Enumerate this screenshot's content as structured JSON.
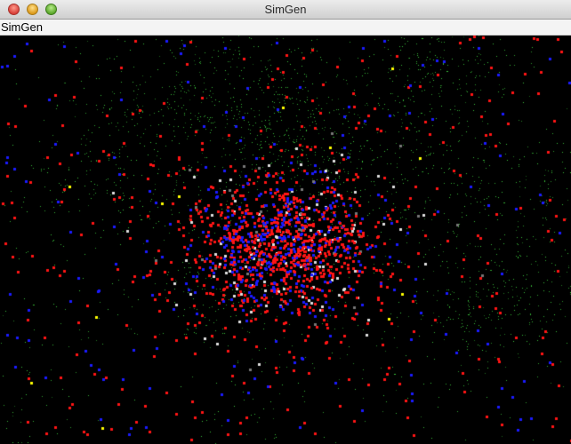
{
  "window": {
    "title": "SimGen"
  },
  "menubar": {
    "items": [
      {
        "label": "SimGen"
      }
    ]
  },
  "simulation": {
    "background": "#000000",
    "particle_colors": {
      "dust": "#39c43a",
      "red": "#ff1414",
      "blue": "#1a1aff",
      "white": "#dddddd",
      "grey": "#777777",
      "yellow": "#ffff00"
    }
  }
}
